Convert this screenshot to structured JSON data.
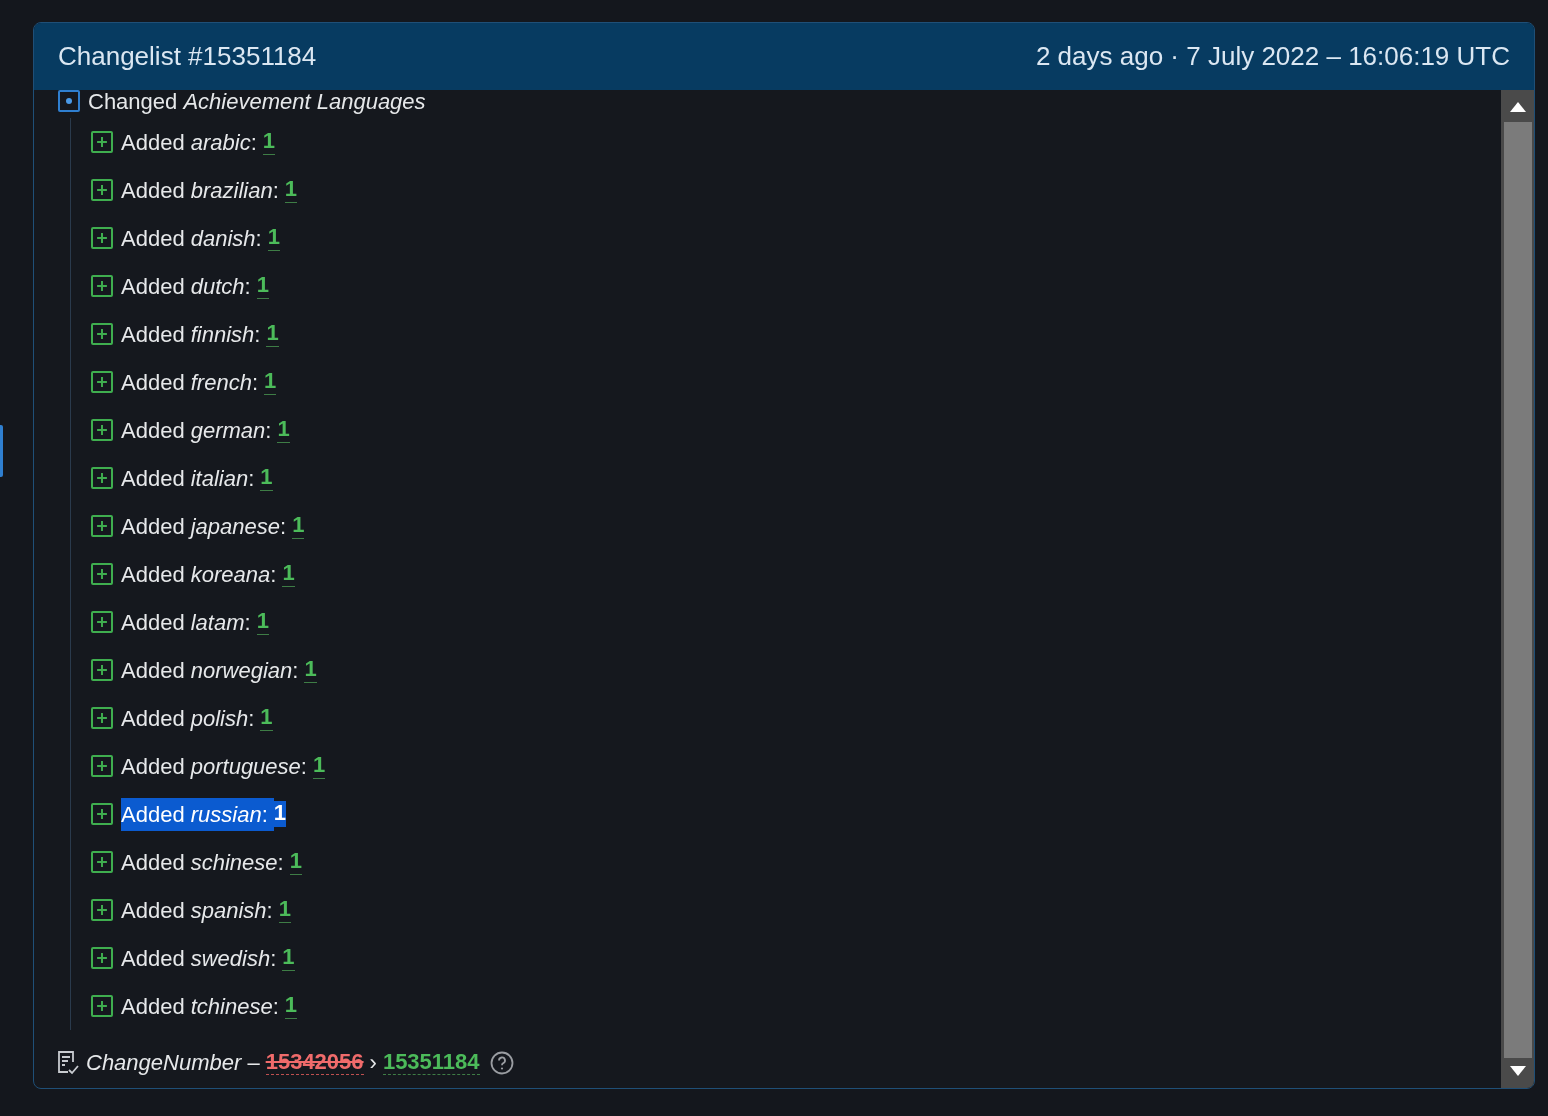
{
  "header": {
    "title": "Changelist #15351184",
    "timestamp": "2 days ago · 7 July 2022 – 16:06:19 UTC"
  },
  "group": {
    "label": "Changed *Achievement Languages*",
    "expanded": true,
    "changes": [
      {
        "kind": "added",
        "label": "Added *arabic*:",
        "value": "1",
        "selected": false
      },
      {
        "kind": "added",
        "label": "Added *brazilian*:",
        "value": "1",
        "selected": false
      },
      {
        "kind": "added",
        "label": "Added *danish*:",
        "value": "1",
        "selected": false
      },
      {
        "kind": "added",
        "label": "Added *dutch*:",
        "value": "1",
        "selected": false
      },
      {
        "kind": "added",
        "label": "Added *finnish*:",
        "value": "1",
        "selected": false
      },
      {
        "kind": "added",
        "label": "Added *french*:",
        "value": "1",
        "selected": false
      },
      {
        "kind": "added",
        "label": "Added *german*:",
        "value": "1",
        "selected": false
      },
      {
        "kind": "added",
        "label": "Added *italian*:",
        "value": "1",
        "selected": false
      },
      {
        "kind": "added",
        "label": "Added *japanese*:",
        "value": "1",
        "selected": false
      },
      {
        "kind": "added",
        "label": "Added *koreana*:",
        "value": "1",
        "selected": false
      },
      {
        "kind": "added",
        "label": "Added *latam*:",
        "value": "1",
        "selected": false
      },
      {
        "kind": "added",
        "label": "Added *norwegian*:",
        "value": "1",
        "selected": false
      },
      {
        "kind": "added",
        "label": "Added *polish*:",
        "value": "1",
        "selected": false
      },
      {
        "kind": "added",
        "label": "Added *portuguese*:",
        "value": "1",
        "selected": false
      },
      {
        "kind": "added",
        "label": "Added *russian*:",
        "value": "1",
        "selected": true
      },
      {
        "kind": "added",
        "label": "Added *schinese*:",
        "value": "1",
        "selected": false
      },
      {
        "kind": "added",
        "label": "Added *spanish*:",
        "value": "1",
        "selected": false
      },
      {
        "kind": "added",
        "label": "Added *swedish*:",
        "value": "1",
        "selected": false
      },
      {
        "kind": "added",
        "label": "Added *tchinese*:",
        "value": "1",
        "selected": false
      }
    ]
  },
  "footer": {
    "label": "*ChangeNumber* –",
    "old_value": "15342056",
    "separator": "›",
    "new_value": "15351184"
  }
}
